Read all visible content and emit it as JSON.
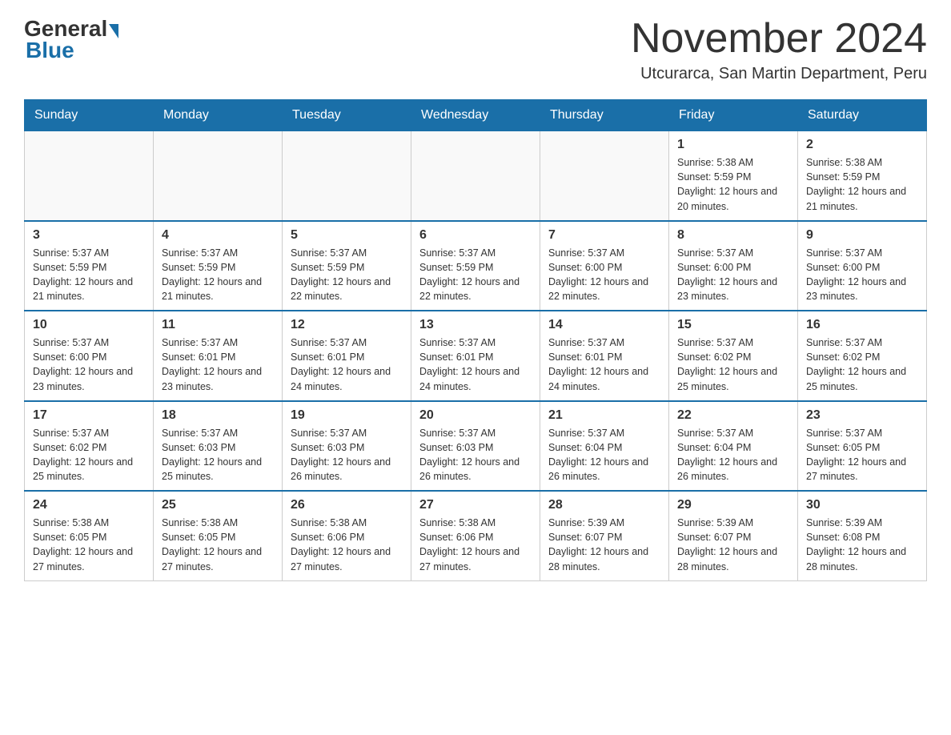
{
  "header": {
    "logo_general": "General",
    "logo_blue": "Blue",
    "month_year": "November 2024",
    "location": "Utcurarca, San Martin Department, Peru"
  },
  "weekdays": [
    "Sunday",
    "Monday",
    "Tuesday",
    "Wednesday",
    "Thursday",
    "Friday",
    "Saturday"
  ],
  "weeks": [
    [
      {
        "day": "",
        "info": ""
      },
      {
        "day": "",
        "info": ""
      },
      {
        "day": "",
        "info": ""
      },
      {
        "day": "",
        "info": ""
      },
      {
        "day": "",
        "info": ""
      },
      {
        "day": "1",
        "info": "Sunrise: 5:38 AM\nSunset: 5:59 PM\nDaylight: 12 hours and 20 minutes."
      },
      {
        "day": "2",
        "info": "Sunrise: 5:38 AM\nSunset: 5:59 PM\nDaylight: 12 hours and 21 minutes."
      }
    ],
    [
      {
        "day": "3",
        "info": "Sunrise: 5:37 AM\nSunset: 5:59 PM\nDaylight: 12 hours and 21 minutes."
      },
      {
        "day": "4",
        "info": "Sunrise: 5:37 AM\nSunset: 5:59 PM\nDaylight: 12 hours and 21 minutes."
      },
      {
        "day": "5",
        "info": "Sunrise: 5:37 AM\nSunset: 5:59 PM\nDaylight: 12 hours and 22 minutes."
      },
      {
        "day": "6",
        "info": "Sunrise: 5:37 AM\nSunset: 5:59 PM\nDaylight: 12 hours and 22 minutes."
      },
      {
        "day": "7",
        "info": "Sunrise: 5:37 AM\nSunset: 6:00 PM\nDaylight: 12 hours and 22 minutes."
      },
      {
        "day": "8",
        "info": "Sunrise: 5:37 AM\nSunset: 6:00 PM\nDaylight: 12 hours and 23 minutes."
      },
      {
        "day": "9",
        "info": "Sunrise: 5:37 AM\nSunset: 6:00 PM\nDaylight: 12 hours and 23 minutes."
      }
    ],
    [
      {
        "day": "10",
        "info": "Sunrise: 5:37 AM\nSunset: 6:00 PM\nDaylight: 12 hours and 23 minutes."
      },
      {
        "day": "11",
        "info": "Sunrise: 5:37 AM\nSunset: 6:01 PM\nDaylight: 12 hours and 23 minutes."
      },
      {
        "day": "12",
        "info": "Sunrise: 5:37 AM\nSunset: 6:01 PM\nDaylight: 12 hours and 24 minutes."
      },
      {
        "day": "13",
        "info": "Sunrise: 5:37 AM\nSunset: 6:01 PM\nDaylight: 12 hours and 24 minutes."
      },
      {
        "day": "14",
        "info": "Sunrise: 5:37 AM\nSunset: 6:01 PM\nDaylight: 12 hours and 24 minutes."
      },
      {
        "day": "15",
        "info": "Sunrise: 5:37 AM\nSunset: 6:02 PM\nDaylight: 12 hours and 25 minutes."
      },
      {
        "day": "16",
        "info": "Sunrise: 5:37 AM\nSunset: 6:02 PM\nDaylight: 12 hours and 25 minutes."
      }
    ],
    [
      {
        "day": "17",
        "info": "Sunrise: 5:37 AM\nSunset: 6:02 PM\nDaylight: 12 hours and 25 minutes."
      },
      {
        "day": "18",
        "info": "Sunrise: 5:37 AM\nSunset: 6:03 PM\nDaylight: 12 hours and 25 minutes."
      },
      {
        "day": "19",
        "info": "Sunrise: 5:37 AM\nSunset: 6:03 PM\nDaylight: 12 hours and 26 minutes."
      },
      {
        "day": "20",
        "info": "Sunrise: 5:37 AM\nSunset: 6:03 PM\nDaylight: 12 hours and 26 minutes."
      },
      {
        "day": "21",
        "info": "Sunrise: 5:37 AM\nSunset: 6:04 PM\nDaylight: 12 hours and 26 minutes."
      },
      {
        "day": "22",
        "info": "Sunrise: 5:37 AM\nSunset: 6:04 PM\nDaylight: 12 hours and 26 minutes."
      },
      {
        "day": "23",
        "info": "Sunrise: 5:37 AM\nSunset: 6:05 PM\nDaylight: 12 hours and 27 minutes."
      }
    ],
    [
      {
        "day": "24",
        "info": "Sunrise: 5:38 AM\nSunset: 6:05 PM\nDaylight: 12 hours and 27 minutes."
      },
      {
        "day": "25",
        "info": "Sunrise: 5:38 AM\nSunset: 6:05 PM\nDaylight: 12 hours and 27 minutes."
      },
      {
        "day": "26",
        "info": "Sunrise: 5:38 AM\nSunset: 6:06 PM\nDaylight: 12 hours and 27 minutes."
      },
      {
        "day": "27",
        "info": "Sunrise: 5:38 AM\nSunset: 6:06 PM\nDaylight: 12 hours and 27 minutes."
      },
      {
        "day": "28",
        "info": "Sunrise: 5:39 AM\nSunset: 6:07 PM\nDaylight: 12 hours and 28 minutes."
      },
      {
        "day": "29",
        "info": "Sunrise: 5:39 AM\nSunset: 6:07 PM\nDaylight: 12 hours and 28 minutes."
      },
      {
        "day": "30",
        "info": "Sunrise: 5:39 AM\nSunset: 6:08 PM\nDaylight: 12 hours and 28 minutes."
      }
    ]
  ]
}
